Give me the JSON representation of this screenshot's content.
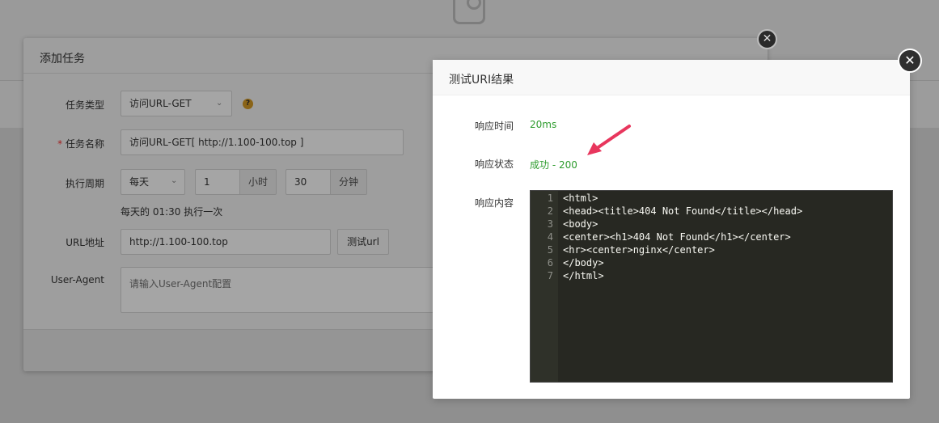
{
  "dialog1": {
    "title": "添加任务",
    "close_icon": "close-icon",
    "fields": {
      "task_type": {
        "label": "任务类型",
        "value": "访问URL-GET"
      },
      "task_name": {
        "label": "任务名称",
        "required_mark": "*",
        "value": "访问URL-GET[ http://1.100-100.top ]"
      },
      "period": {
        "label": "执行周期",
        "unit": "每天",
        "hour_value": "1",
        "hour_addon": "小时",
        "minute_value": "30",
        "minute_addon": "分钟",
        "hint": "每天的 01:30 执行一次"
      },
      "url": {
        "label": "URL地址",
        "value": "http://1.100-100.top",
        "test_button": "测试url"
      },
      "user_agent": {
        "label": "User-Agent",
        "placeholder": "请输入User-Agent配置"
      }
    },
    "help_icon": "question-circle-icon"
  },
  "dialog2": {
    "title": "测试URI结果",
    "close_icon": "close-icon",
    "rows": {
      "time": {
        "label": "响应时间",
        "value": "20ms"
      },
      "status": {
        "label": "响应状态",
        "value": "成功 - 200"
      },
      "content": {
        "label": "响应内容"
      }
    },
    "code": {
      "line_numbers": [
        "1",
        "2",
        "3",
        "4",
        "5",
        "6",
        "7"
      ],
      "lines": [
        "<html>",
        "<head><title>404 Not Found</title></head>",
        "<body>",
        "<center><h1>404 Not Found</h1></center>",
        "<hr><center>nginx</center>",
        "</body>",
        "</html>"
      ]
    },
    "annotation_icon": "red-arrow-icon"
  },
  "colors": {
    "success_green": "#2e9c2e",
    "editor_bg": "#272822",
    "arrow_red": "#e8365d"
  }
}
